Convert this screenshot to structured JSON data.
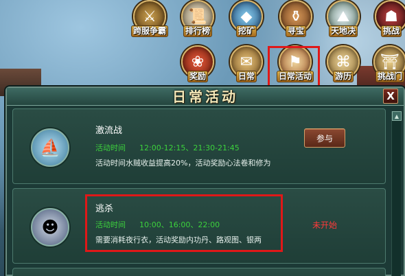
{
  "top_icons": [
    {
      "label": "跨服争霸",
      "icon": "crossed-swords-dragon-icon"
    },
    {
      "label": "排行榜",
      "icon": "ranking-scroll-icon"
    },
    {
      "label": "挖矿",
      "icon": "crystal-mining-icon"
    },
    {
      "label": "寻宝",
      "icon": "treasure-jar-icon"
    },
    {
      "label": "天地决",
      "icon": "mountain-landscape-icon"
    },
    {
      "label": "挑战",
      "icon": "fighter-portrait-icon"
    },
    {
      "label": "奖励",
      "icon": "reward-bag-icon"
    },
    {
      "label": "日常",
      "icon": "daily-scroll-icon"
    },
    {
      "label": "日常活动",
      "icon": "daily-activity-flag-icon"
    },
    {
      "label": "游历",
      "icon": "travel-map-icon"
    },
    {
      "label": "挑战门",
      "icon": "challenge-gate-icon"
    }
  ],
  "panel": {
    "title": "日常活动",
    "close_label": "X",
    "scroll_up_glyph": "▲"
  },
  "activities": [
    {
      "name": "激流战",
      "time_label": "活动时间",
      "time": "12:00-12:15、21:30-21:45",
      "description": "活动时间水贼收益提高20%，活动奖励心法卷和修为",
      "action": "参与",
      "icon": "flying-boat-icon"
    },
    {
      "name": "逃杀",
      "time_label": "活动时间",
      "time": "10:00、16:00、22:00",
      "description": "需要消耗夜行衣，活动奖励内功丹、路观图、银两",
      "status": "未开始",
      "icon": "masked-ninja-icon"
    }
  ],
  "colors": {
    "highlight": "#e01818",
    "time_text": "#3cd23c",
    "status_text": "#ff3a3a",
    "panel_bg": "#1c3a36"
  }
}
